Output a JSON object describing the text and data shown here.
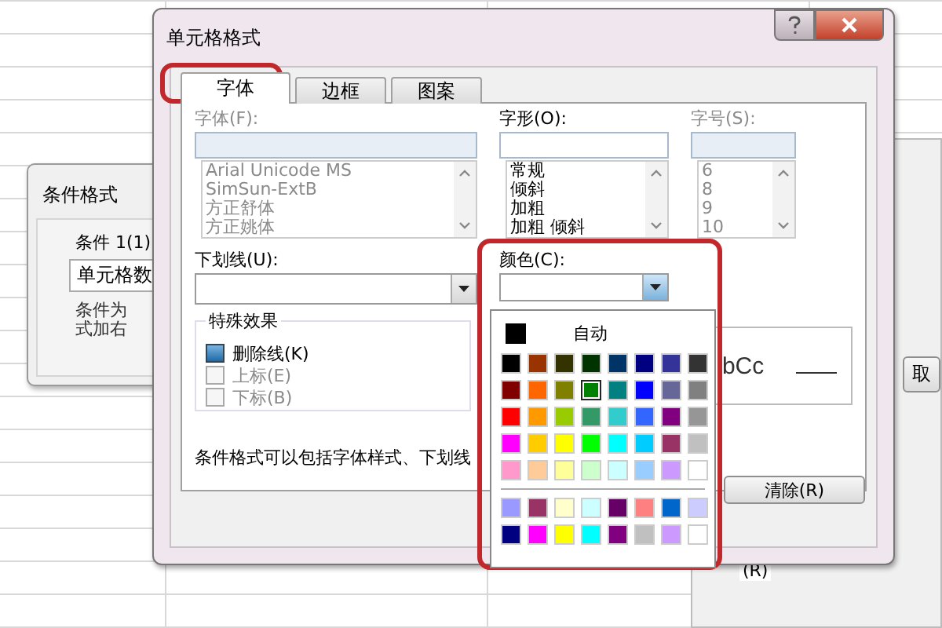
{
  "back_dialog": {
    "title": "条件格式",
    "condition_label": "条件 1(1)",
    "condition_field": "单元格数",
    "description_lines": [
      "条件为",
      "式加右"
    ]
  },
  "right_dialog": {
    "button": "取",
    "bottom_label": "(R)"
  },
  "dialog": {
    "title": "单元格格式",
    "tabs": [
      {
        "label": "字体",
        "selected": true
      },
      {
        "label": "边框",
        "selected": false
      },
      {
        "label": "图案",
        "selected": false
      }
    ],
    "font": {
      "label": "字体(F):",
      "disabled": true,
      "items": [
        "Arial Unicode MS",
        "SimSun-ExtB",
        "方正舒体",
        "方正姚体"
      ]
    },
    "font_style": {
      "label": "字形(O):",
      "disabled": false,
      "items": [
        "常规",
        "倾斜",
        "加粗",
        "加粗 倾斜"
      ]
    },
    "font_size": {
      "label": "字号(S):",
      "disabled": true,
      "items": [
        "6",
        "8",
        "9",
        "10"
      ]
    },
    "underline": {
      "label": "下划线(U):"
    },
    "color": {
      "label": "颜色(C):"
    },
    "effects": {
      "title": "特殊效果",
      "options": [
        {
          "label": "删除线(K)",
          "checked": true,
          "disabled": false
        },
        {
          "label": "上标(E)",
          "checked": false,
          "disabled": true
        },
        {
          "label": "下标(B)",
          "checked": false,
          "disabled": true
        }
      ]
    },
    "preview": {
      "text": "bCc"
    },
    "note": "条件格式可以包括字体样式、下划线",
    "clear_button": "清除(R)"
  },
  "color_popup": {
    "auto_label": "自动",
    "standard": [
      [
        {
          "color": "#000000",
          "selected": false
        },
        {
          "color": "#993300",
          "selected": false
        },
        {
          "color": "#333300",
          "selected": false
        },
        {
          "color": "#003300",
          "selected": false
        },
        {
          "color": "#003366",
          "selected": false
        },
        {
          "color": "#000080",
          "selected": false
        },
        {
          "color": "#333399",
          "selected": false
        },
        {
          "color": "#333333",
          "selected": false
        }
      ],
      [
        {
          "color": "#800000",
          "selected": false
        },
        {
          "color": "#ff6600",
          "selected": false
        },
        {
          "color": "#808000",
          "selected": false
        },
        {
          "color": "#008000",
          "selected": true
        },
        {
          "color": "#008080",
          "selected": false
        },
        {
          "color": "#0000ff",
          "selected": false
        },
        {
          "color": "#666699",
          "selected": false
        },
        {
          "color": "#808080",
          "selected": false
        }
      ],
      [
        {
          "color": "#ff0000",
          "selected": false
        },
        {
          "color": "#ff9900",
          "selected": false
        },
        {
          "color": "#99cc00",
          "selected": false
        },
        {
          "color": "#339966",
          "selected": false
        },
        {
          "color": "#33cccc",
          "selected": false
        },
        {
          "color": "#3366ff",
          "selected": false
        },
        {
          "color": "#800080",
          "selected": false
        },
        {
          "color": "#969696",
          "selected": false
        }
      ],
      [
        {
          "color": "#ff00ff",
          "selected": false
        },
        {
          "color": "#ffcc00",
          "selected": false
        },
        {
          "color": "#ffff00",
          "selected": false
        },
        {
          "color": "#00ff00",
          "selected": false
        },
        {
          "color": "#00ffff",
          "selected": false
        },
        {
          "color": "#00ccff",
          "selected": false
        },
        {
          "color": "#993366",
          "selected": false
        },
        {
          "color": "#c0c0c0",
          "selected": false
        }
      ],
      [
        {
          "color": "#ff99cc",
          "selected": false
        },
        {
          "color": "#ffcc99",
          "selected": false
        },
        {
          "color": "#ffff99",
          "selected": false
        },
        {
          "color": "#ccffcc",
          "selected": false
        },
        {
          "color": "#ccffff",
          "selected": false
        },
        {
          "color": "#99ccff",
          "selected": false
        },
        {
          "color": "#cc99ff",
          "selected": false
        },
        {
          "color": "#ffffff",
          "selected": false
        }
      ]
    ],
    "extra": [
      [
        {
          "color": "#9999ff",
          "selected": false
        },
        {
          "color": "#993366",
          "selected": false
        },
        {
          "color": "#ffffcc",
          "selected": false
        },
        {
          "color": "#ccffff",
          "selected": false
        },
        {
          "color": "#660066",
          "selected": false
        },
        {
          "color": "#ff8080",
          "selected": false
        },
        {
          "color": "#0066cc",
          "selected": false
        },
        {
          "color": "#ccccff",
          "selected": false
        }
      ],
      [
        {
          "color": "#000080",
          "selected": false
        },
        {
          "color": "#ff00ff",
          "selected": false
        },
        {
          "color": "#ffff00",
          "selected": false
        },
        {
          "color": "#00ffff",
          "selected": false
        },
        {
          "color": "#800080",
          "selected": false
        },
        {
          "color": "#c0c0c0",
          "selected": false
        },
        {
          "color": "#cc99ff",
          "selected": false
        },
        {
          "color": "#ffffff",
          "selected": false
        }
      ]
    ]
  }
}
